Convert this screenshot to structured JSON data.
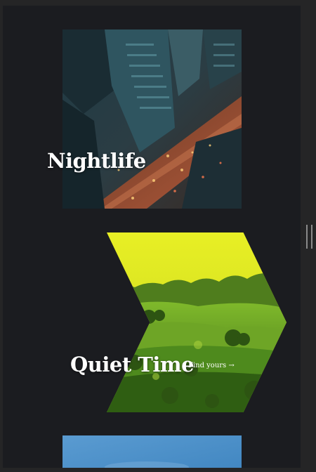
{
  "cards": [
    {
      "title": "Nightlife",
      "image": "city-night-aerial-image"
    },
    {
      "title": "Quiet Time",
      "link": "Find yours →",
      "image": "green-hills-image"
    },
    {
      "image": "sky-image"
    }
  ],
  "colors": {
    "page_bg": "#1b1c20",
    "chrome_bg": "#252526",
    "title_text": "#ffffff",
    "quiet_tint": "#d7e81a",
    "sky_blue": "#4f93c9"
  }
}
